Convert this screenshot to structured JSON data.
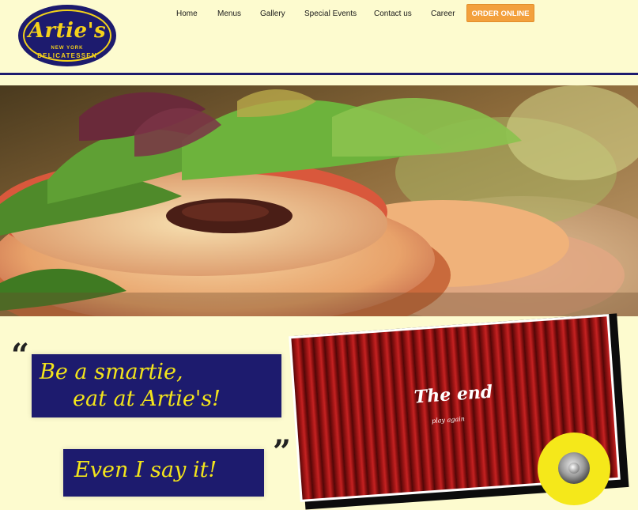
{
  "brand": {
    "name": "Artie's",
    "tagline_small": "NEW YORK",
    "tagline": "DELICATESSEN",
    "navy": "#1d1b6e",
    "yellow": "#f5d21b",
    "background": "#fdfbcf",
    "accent_orange": "#f3a03c"
  },
  "nav": {
    "items": [
      {
        "label": "Home"
      },
      {
        "label": "Menus"
      },
      {
        "label": "Gallery"
      },
      {
        "label": "Special Events"
      },
      {
        "label": "Contact us"
      },
      {
        "label": "Career"
      }
    ],
    "order_button": "ORDER ONLINE"
  },
  "quote": {
    "open_mark": "“",
    "close_mark": "”",
    "line1": "Be a smartie,",
    "line2": "eat at Artie's!",
    "line3": "Even I say it!"
  },
  "video": {
    "title": "The end",
    "subtitle": "play again",
    "icon": "speaker-icon"
  }
}
